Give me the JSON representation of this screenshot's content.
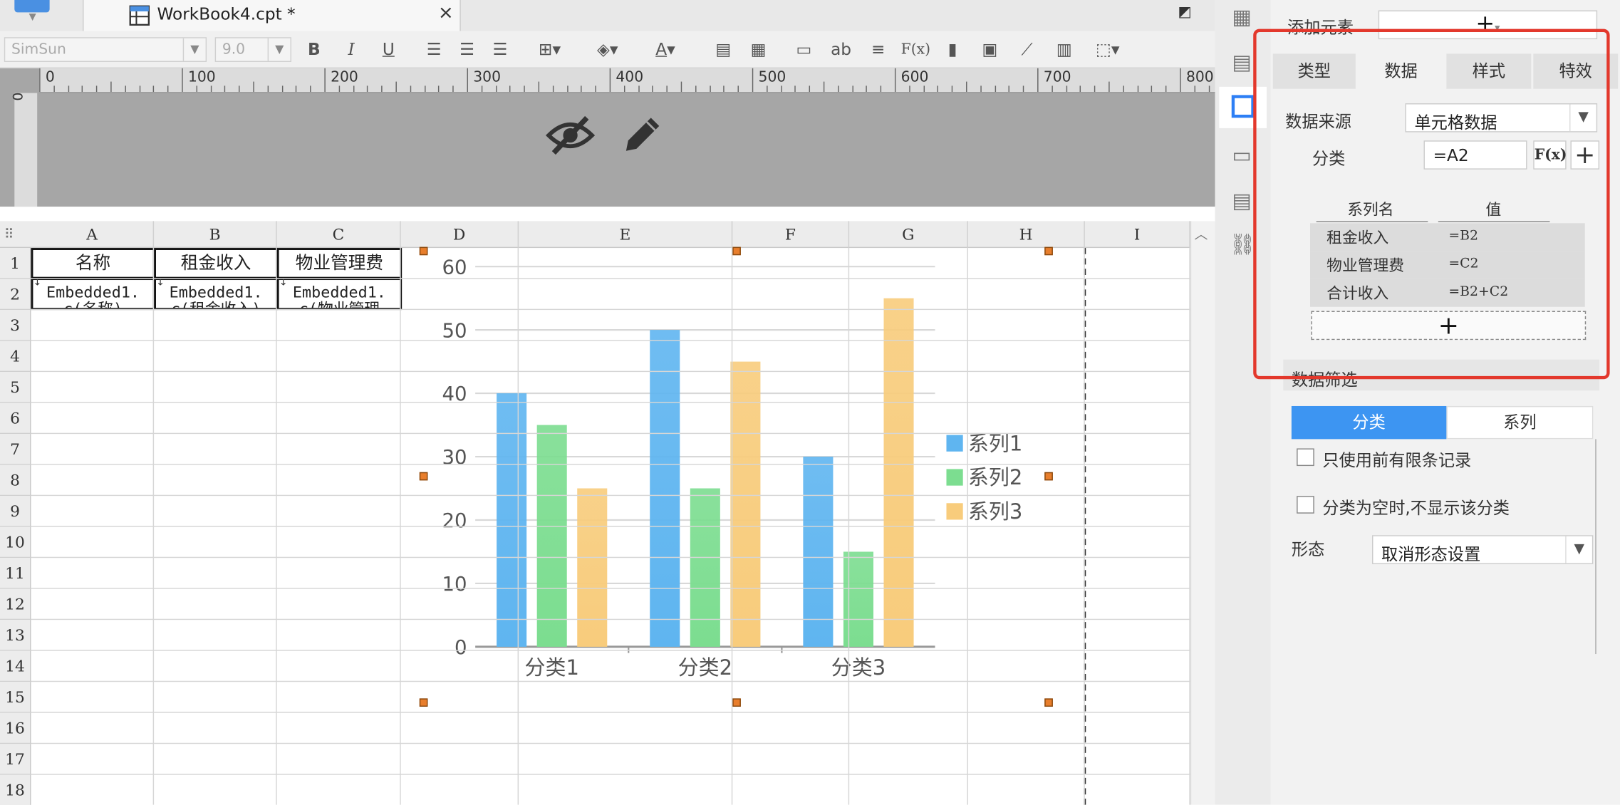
{
  "tab": {
    "title": "WorkBook4.cpt *",
    "close": "×"
  },
  "toolbar": {
    "font": "SimSun",
    "size": "9.0",
    "bold": "B",
    "italic": "I",
    "underline": "U"
  },
  "ruler": {
    "h_labels": [
      "0",
      "100",
      "200",
      "300",
      "400",
      "500",
      "600",
      "700",
      "800"
    ],
    "v_label": "0"
  },
  "sheet": {
    "columns": [
      "A",
      "B",
      "C",
      "D",
      "E",
      "F",
      "G",
      "H",
      "I"
    ],
    "rows": [
      "1",
      "2",
      "3",
      "4",
      "5",
      "6",
      "7",
      "8",
      "9",
      "10",
      "11",
      "12",
      "13",
      "14",
      "15",
      "16",
      "17",
      "18"
    ],
    "header_cells": [
      "名称",
      "租金收入",
      "物业管理费"
    ],
    "data_cells": [
      "Embedded1.\nc(名称)",
      "Embedded1.\nc(租金收入)",
      "Embedded1.\nc(物业管理"
    ]
  },
  "chart_data": {
    "type": "bar",
    "categories": [
      "分类1",
      "分类2",
      "分类3"
    ],
    "series": [
      {
        "name": "系列1",
        "values": [
          40,
          50,
          30
        ],
        "color": "#5fb5f0"
      },
      {
        "name": "系列2",
        "values": [
          35,
          25,
          15
        ],
        "color": "#7cdd90"
      },
      {
        "name": "系列3",
        "values": [
          25,
          45,
          55
        ],
        "color": "#f8cc7c"
      }
    ],
    "ylim": [
      0,
      60
    ],
    "yticks": [
      "0",
      "10",
      "20",
      "30",
      "40",
      "50",
      "60"
    ],
    "grid": true,
    "legend": "right"
  },
  "panel": {
    "add_element": "添加元素",
    "tabs": [
      "类型",
      "数据",
      "样式",
      "特效"
    ],
    "data_source_label": "数据来源",
    "data_source_value": "单元格数据",
    "category_label": "分类",
    "category_value": "=A2",
    "fx": "F(x)",
    "series_header": {
      "name": "系列名",
      "value": "值"
    },
    "series_rows": [
      {
        "name": "租金收入",
        "value": "=B2"
      },
      {
        "name": "物业管理费",
        "value": "=C2"
      },
      {
        "name": "合计收入",
        "value": "=B2+C2"
      }
    ],
    "filter_label": "数据筛选",
    "filter_tabs": [
      "分类",
      "系列"
    ],
    "check1": "只使用前有限条记录",
    "check2": "分类为空时,不显示该分类",
    "shape_label": "形态",
    "shape_value": "取消形态设置"
  }
}
